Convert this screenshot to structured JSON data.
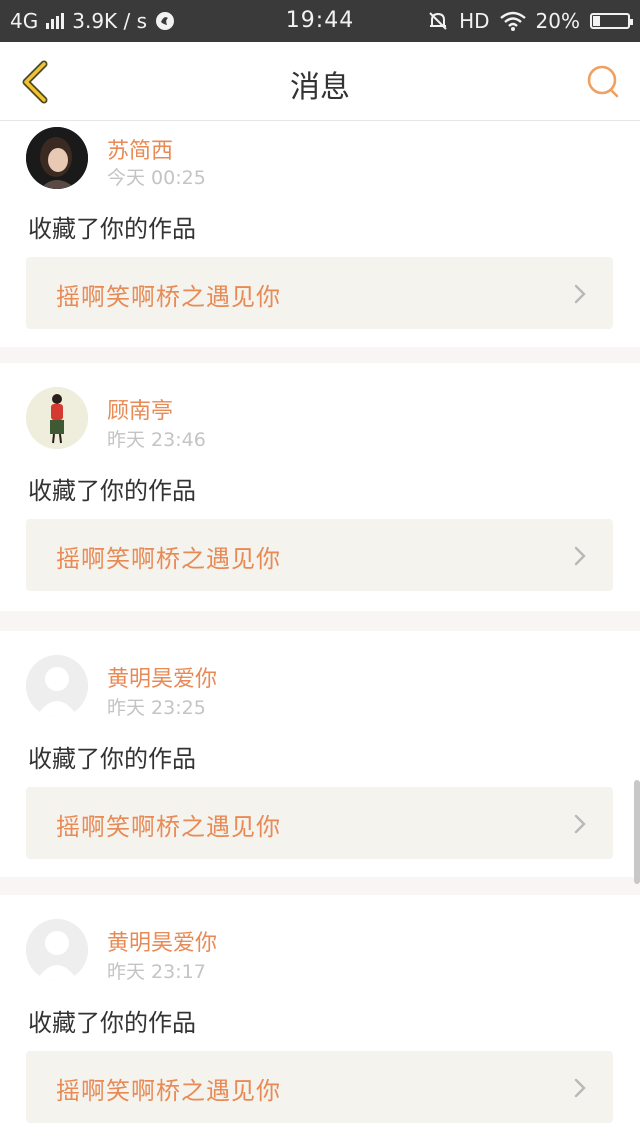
{
  "status_bar": {
    "network": "4G",
    "speed": "3.9K / s",
    "time": "19:44",
    "hd": "HD",
    "battery": "20%",
    "battery_level": 0.2
  },
  "header": {
    "title": "消息",
    "back_icon": "chevron-left-icon",
    "search_icon": "search-icon"
  },
  "messages": [
    {
      "user": "苏简西",
      "time": "今天 00:25",
      "action": "收藏了你的作品",
      "work": "摇啊笑啊桥之遇见你",
      "avatar": "photo"
    },
    {
      "user": "顾南亭",
      "time": "昨天 23:46",
      "action": "收藏了你的作品",
      "work": "摇啊笑啊桥之遇见你",
      "avatar": "illustration"
    },
    {
      "user": "黄明昊爱你",
      "time": "昨天 23:25",
      "action": "收藏了你的作品",
      "work": "摇啊笑啊桥之遇见你",
      "avatar": "default"
    },
    {
      "user": "黄明昊爱你",
      "time": "昨天 23:17",
      "action": "收藏了你的作品",
      "work": "摇啊笑啊桥之遇见你",
      "avatar": "default"
    }
  ],
  "colors": {
    "accent": "#e88a55",
    "status_bar_bg": "#3a3a3a",
    "card_bg": "#f4f3ee",
    "divider": "#f9f5f4"
  }
}
